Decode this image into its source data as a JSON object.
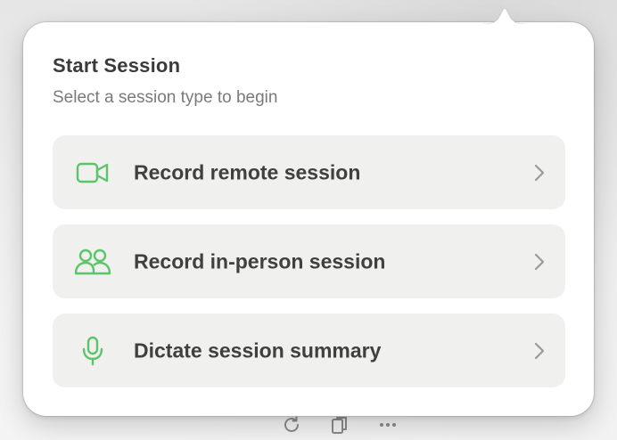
{
  "popover": {
    "title": "Start Session",
    "subtitle": "Select a session type to begin",
    "options": [
      {
        "label": "Record remote session",
        "icon": "video-camera-icon"
      },
      {
        "label": "Record in-person session",
        "icon": "people-icon"
      },
      {
        "label": "Dictate session summary",
        "icon": "microphone-icon"
      }
    ]
  },
  "colors": {
    "accent_green": "#5cc46a",
    "option_bg": "#f0f0ee",
    "title": "#3a3a3a",
    "subtitle": "#7a7a7a",
    "chevron": "#9a9a9a"
  },
  "toolbar": {
    "icons": [
      "refresh-icon",
      "documents-icon",
      "more-icon"
    ]
  }
}
